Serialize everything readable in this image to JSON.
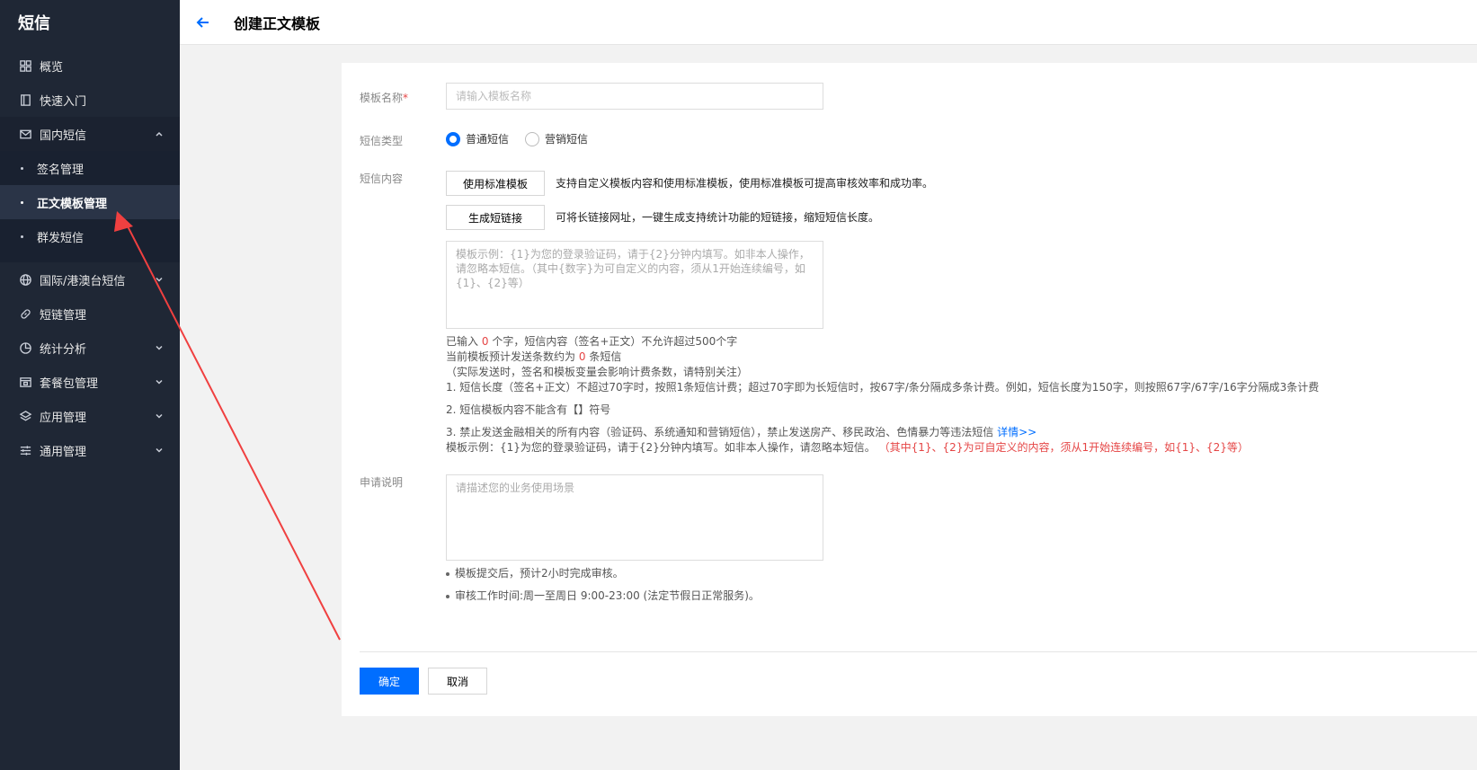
{
  "sidebar": {
    "brand": "短信",
    "items": [
      {
        "label": "概览"
      },
      {
        "label": "快速入门"
      },
      {
        "label": "国内短信"
      },
      {
        "label": "国际/港澳台短信"
      },
      {
        "label": "短链管理"
      },
      {
        "label": "统计分析"
      },
      {
        "label": "套餐包管理"
      },
      {
        "label": "应用管理"
      },
      {
        "label": "通用管理"
      }
    ],
    "sub_items": [
      {
        "label": "签名管理"
      },
      {
        "label": "正文模板管理"
      },
      {
        "label": "群发短信"
      }
    ]
  },
  "header": {
    "title": "创建正文模板"
  },
  "form": {
    "name_label": "模板名称",
    "name_required": "*",
    "name_placeholder": "请输入模板名称",
    "type_label": "短信类型",
    "type_options": [
      "普通短信",
      "营销短信"
    ],
    "type_selected": "普通短信",
    "content_label": "短信内容",
    "use_template_button": "使用标准模板",
    "use_template_hint": "支持自定义模板内容和使用标准模板，使用标准模板可提高审核效率和成功率。",
    "short_link_button": "生成短链接",
    "short_link_hint": "可将长链接网址，一键生成支持统计功能的短链接，缩短短信长度。",
    "content_placeholder": "模板示例：{1}为您的登录验证码，请于{2}分钟内填写。如非本人操作，请忽略本短信。（其中{数字}为可自定义的内容，须从1开始连续编号，如{1}、{2}等）",
    "count_prefix": "已输入",
    "count_value": "0",
    "count_suffix": "个字，短信内容（签名+正文）不允许超过500个字",
    "estimate_prefix": "当前模板预计发送条数约为",
    "estimate_value": "0",
    "estimate_suffix": "条短信",
    "billing_notice": "（实际发送时，签名和模板变量会影响计费条数，请特别关注）",
    "rule_1": "1. 短信长度（签名+正文）不超过70字时，按照1条短信计费；超过70字即为长短信时，按67字/条分隔成多条计费。例如，短信长度为150字，则按照67字/67字/16字分隔成3条计费",
    "rule_2": "2. 短信模板内容不能含有【】符号",
    "rule_3": "3. 禁止发送金融相关的所有内容（验证码、系统通知和营销短信），禁止发送房产、移民政治、色情暴力等违法短信",
    "rule_3_link": "详情>>",
    "example_text": "模板示例：{1}为您的登录验证码，请于{2}分钟内填写。如非本人操作，请忽略本短信。",
    "example_note": "（其中{1}、{2}为可自定义的内容，须从1开始连续编号，如{1}、{2}等）",
    "desc_label": "申请说明",
    "desc_placeholder": "请描述您的业务使用场景",
    "note_1": "模板提交后，预计2小时完成审核。",
    "note_2": "审核工作时间:周一至周日 9:00-23:00 (法定节假日正常服务)。",
    "confirm_button": "确定",
    "cancel_button": "取消"
  },
  "colors": {
    "primary": "#006eff",
    "sidebar_bg": "#1f2735",
    "warning": "#e54545",
    "annotation_arrow": "#f04040"
  }
}
